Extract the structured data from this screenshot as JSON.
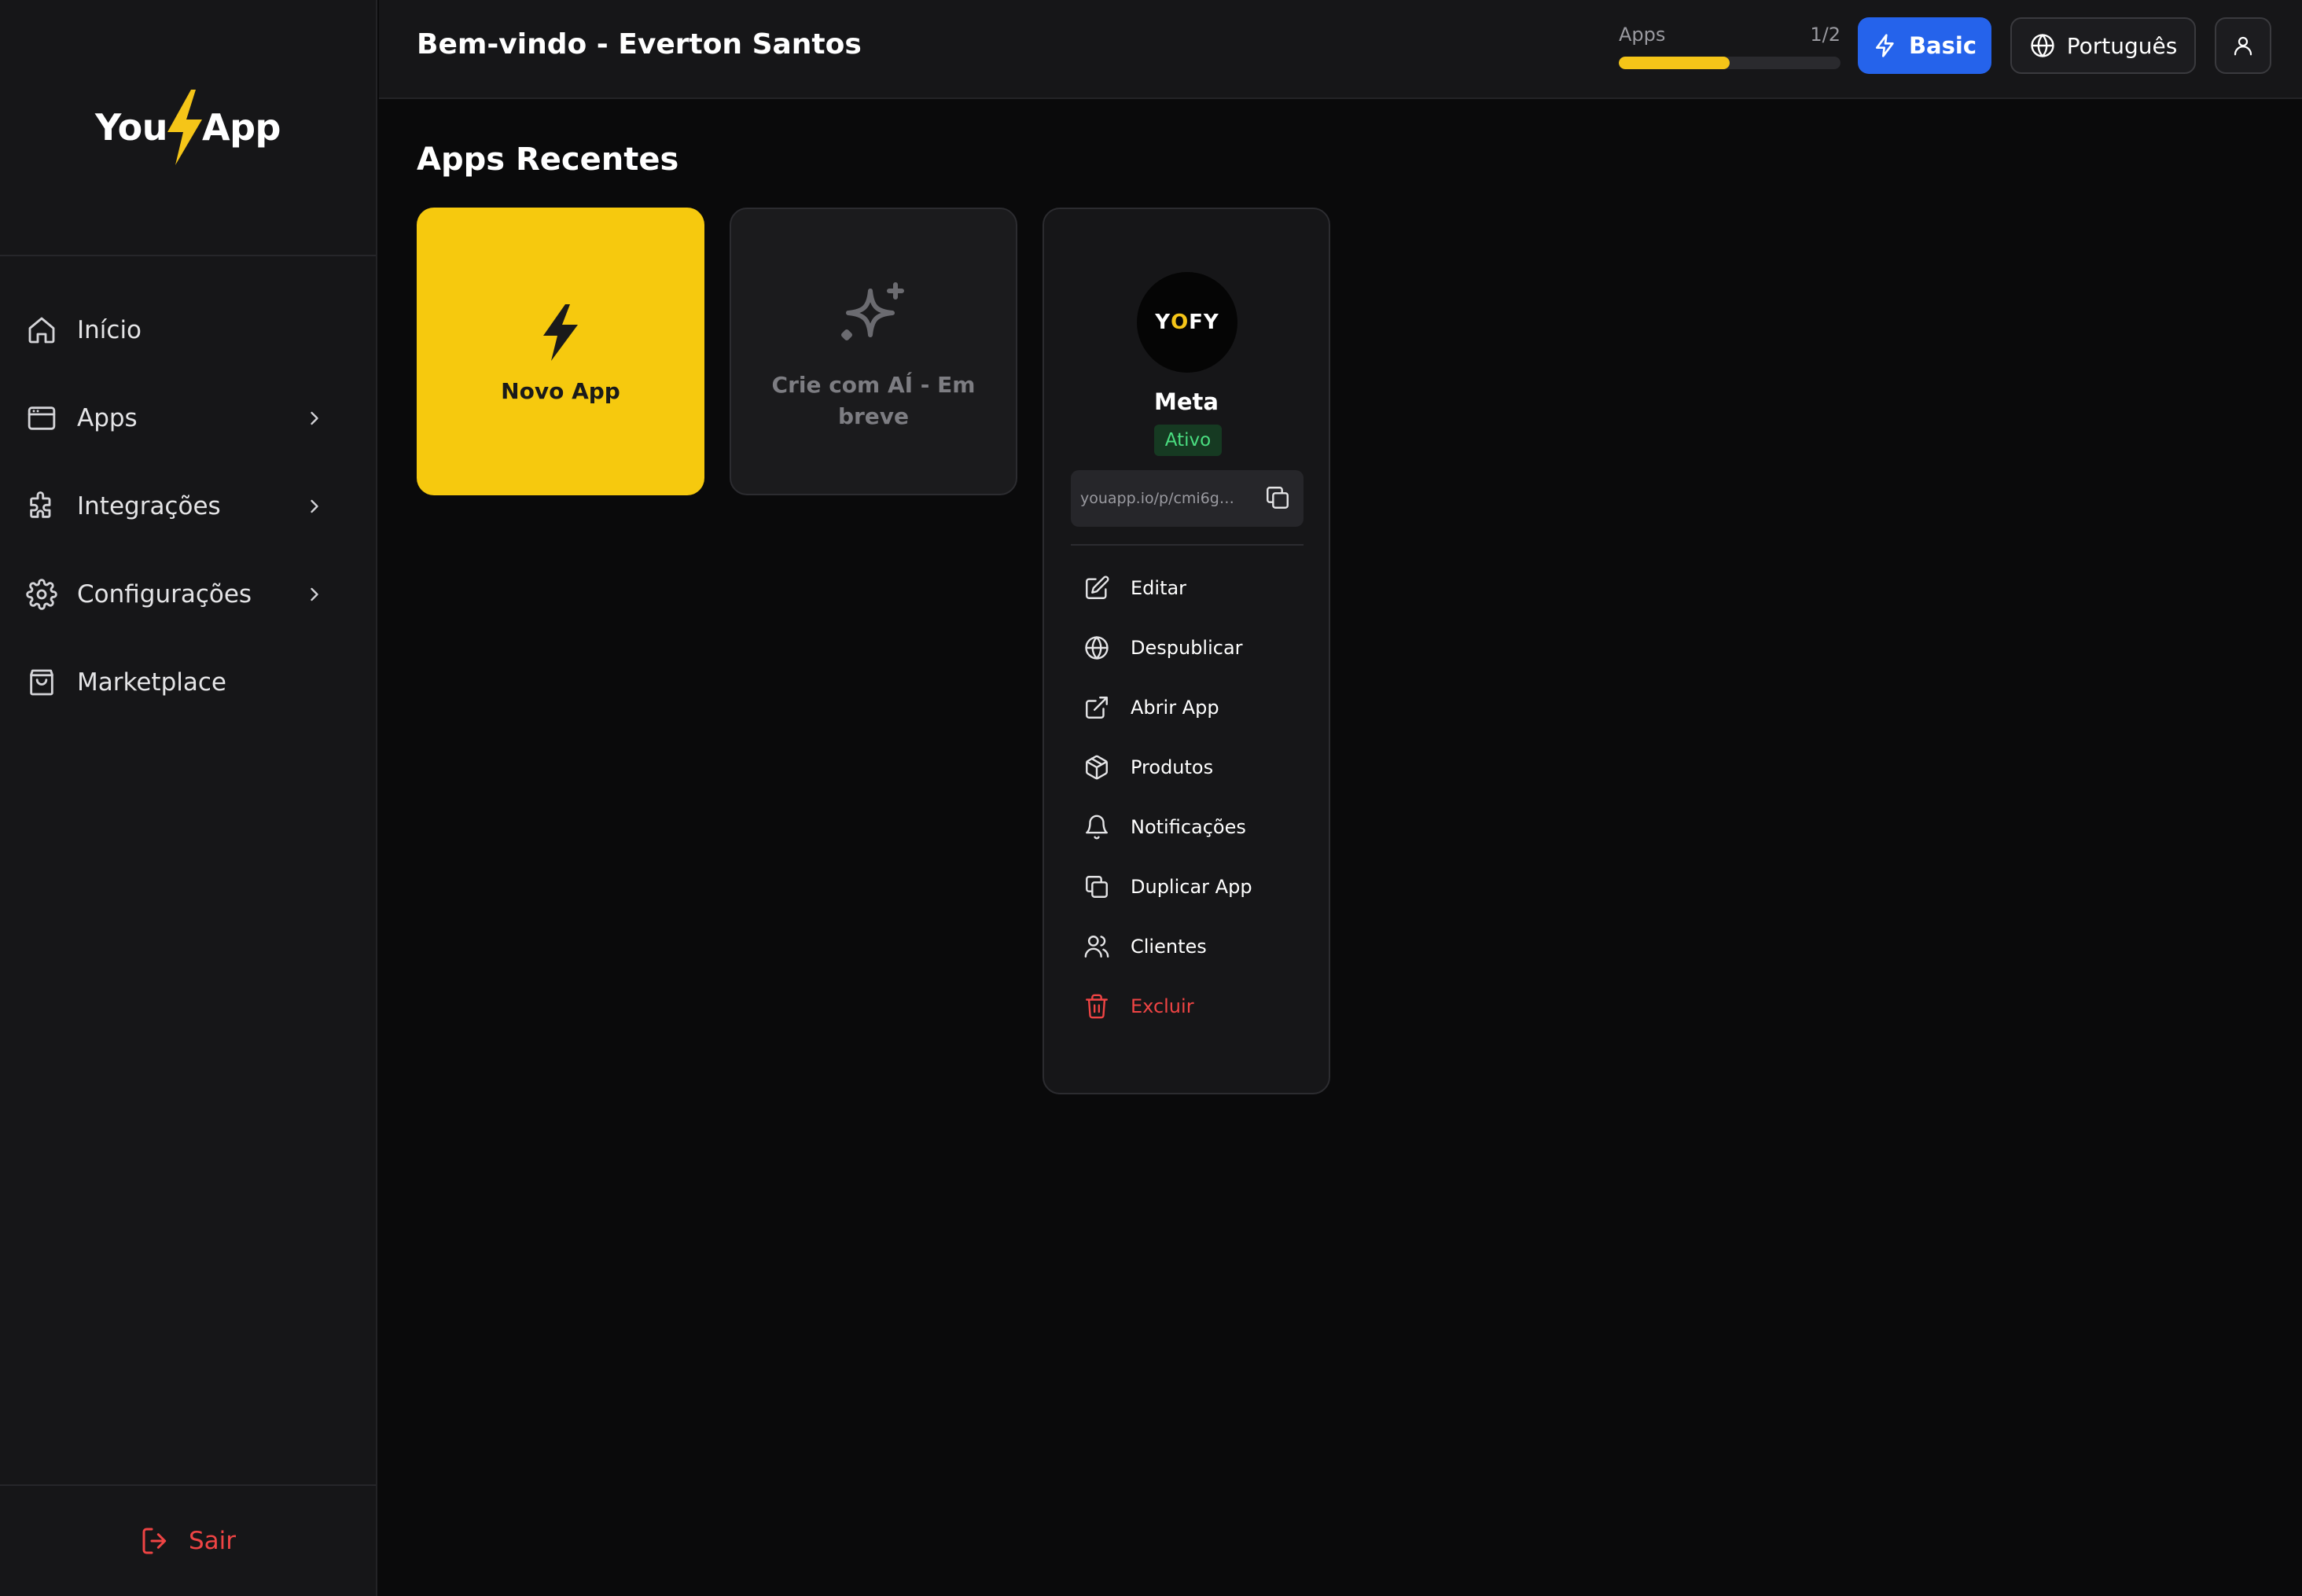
{
  "brand": {
    "logo_left": "You",
    "logo_right": "App",
    "accent": "#f5c518"
  },
  "sidebar": {
    "items": [
      {
        "label": "Início",
        "icon": "home-icon",
        "has_chevron": false
      },
      {
        "label": "Apps",
        "icon": "app-window-icon",
        "has_chevron": true
      },
      {
        "label": "Integrações",
        "icon": "puzzle-icon",
        "has_chevron": true
      },
      {
        "label": "Configurações",
        "icon": "gear-icon",
        "has_chevron": true
      },
      {
        "label": "Marketplace",
        "icon": "shopping-bag-icon",
        "has_chevron": false
      }
    ],
    "logout_label": "Sair"
  },
  "header": {
    "title": "Bem-vindo - Everton Santos",
    "usage_label": "Apps",
    "usage_count": "1/2",
    "usage_used": 1,
    "usage_total": 2,
    "plan_label": "Basic",
    "plan_color": "#2563eb",
    "language_label": "Português"
  },
  "main": {
    "section_title": "Apps Recentes",
    "new_app_label": "Novo App",
    "ai_card_label": "Crie com AÍ - Em breve",
    "app_card": {
      "avatar_text_left": "Y",
      "avatar_text_mid": "O",
      "avatar_text_right": "FY",
      "name": "Meta",
      "status": "Ativo",
      "url": "youapp.io/p/cmi6g3...",
      "menu": [
        {
          "label": "Editar",
          "icon": "edit-icon"
        },
        {
          "label": "Despublicar",
          "icon": "globe-icon"
        },
        {
          "label": "Abrir App",
          "icon": "external-link-icon"
        },
        {
          "label": "Produtos",
          "icon": "package-icon"
        },
        {
          "label": "Notificações",
          "icon": "bell-icon"
        },
        {
          "label": "Duplicar App",
          "icon": "copy-icon"
        },
        {
          "label": "Clientes",
          "icon": "users-icon"
        },
        {
          "label": "Excluir",
          "icon": "trash-icon"
        }
      ]
    }
  }
}
